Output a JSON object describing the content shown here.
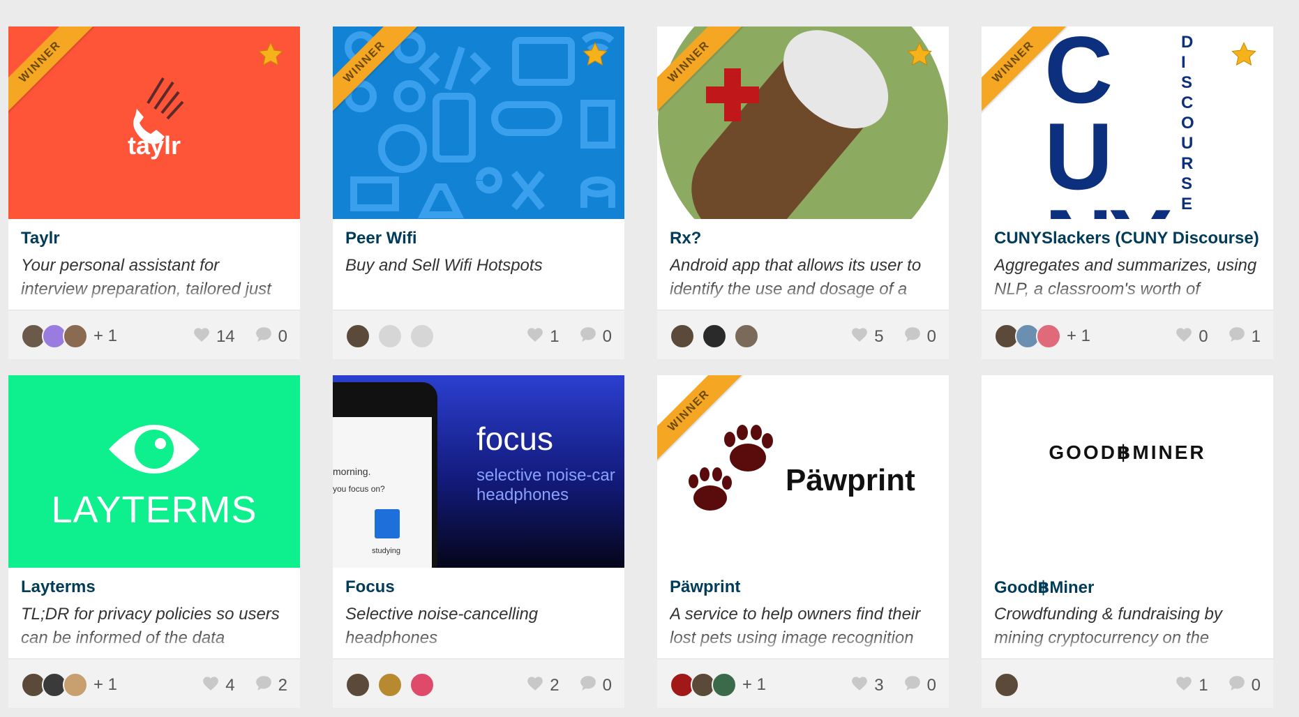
{
  "ribbon_label": "WINNER",
  "accent_colors": {
    "ribbon": "#f5a623",
    "title": "#003b58",
    "star": "#f5b21b"
  },
  "cards": [
    {
      "title": "Taylr",
      "desc": "Your personal assistant for interview preparation, tailored just",
      "more": "+ 1",
      "likes": "14",
      "comments": "0",
      "thumb_text": "taylr"
    },
    {
      "title": "Peer Wifi",
      "desc": "Buy and Sell Wifi Hotspots",
      "more": "",
      "likes": "1",
      "comments": "0"
    },
    {
      "title": "Rx?",
      "desc": "Android app that allows its user to identify the use and dosage of a",
      "more": "",
      "likes": "5",
      "comments": "0"
    },
    {
      "title": "CUNYSlackers (CUNY Discourse)",
      "desc": "Aggregates and summarizes, using NLP, a classroom's worth of",
      "more": "+ 1",
      "likes": "0",
      "comments": "1",
      "thumb_text": "CUNY",
      "thumb_text2": "DISCOURSE"
    },
    {
      "title": "Layterms",
      "desc": "TL;DR for privacy policies so users can be informed of the data",
      "more": "+ 1",
      "likes": "4",
      "comments": "2",
      "thumb_text": "LAYTERMS"
    },
    {
      "title": "Focus",
      "desc": "Selective noise-cancelling headphones",
      "more": "",
      "likes": "2",
      "comments": "0",
      "thumb_text": "focus",
      "thumb_text2": "selective noise-car",
      "thumb_text3": "headphones",
      "thumb_text4": "morning.",
      "thumb_text5": "you focus on?",
      "thumb_text6": "studying"
    },
    {
      "title": "Päwprint",
      "desc": "A service to help owners find their lost pets using image recognition",
      "more": "+ 1",
      "likes": "3",
      "comments": "0",
      "thumb_text": "Päwprint"
    },
    {
      "title": "Good฿Miner",
      "desc": "Crowdfunding & fundraising by mining cryptocurrency on the",
      "more": "",
      "likes": "1",
      "comments": "0",
      "thumb_text": "GOOD฿MINER"
    }
  ]
}
